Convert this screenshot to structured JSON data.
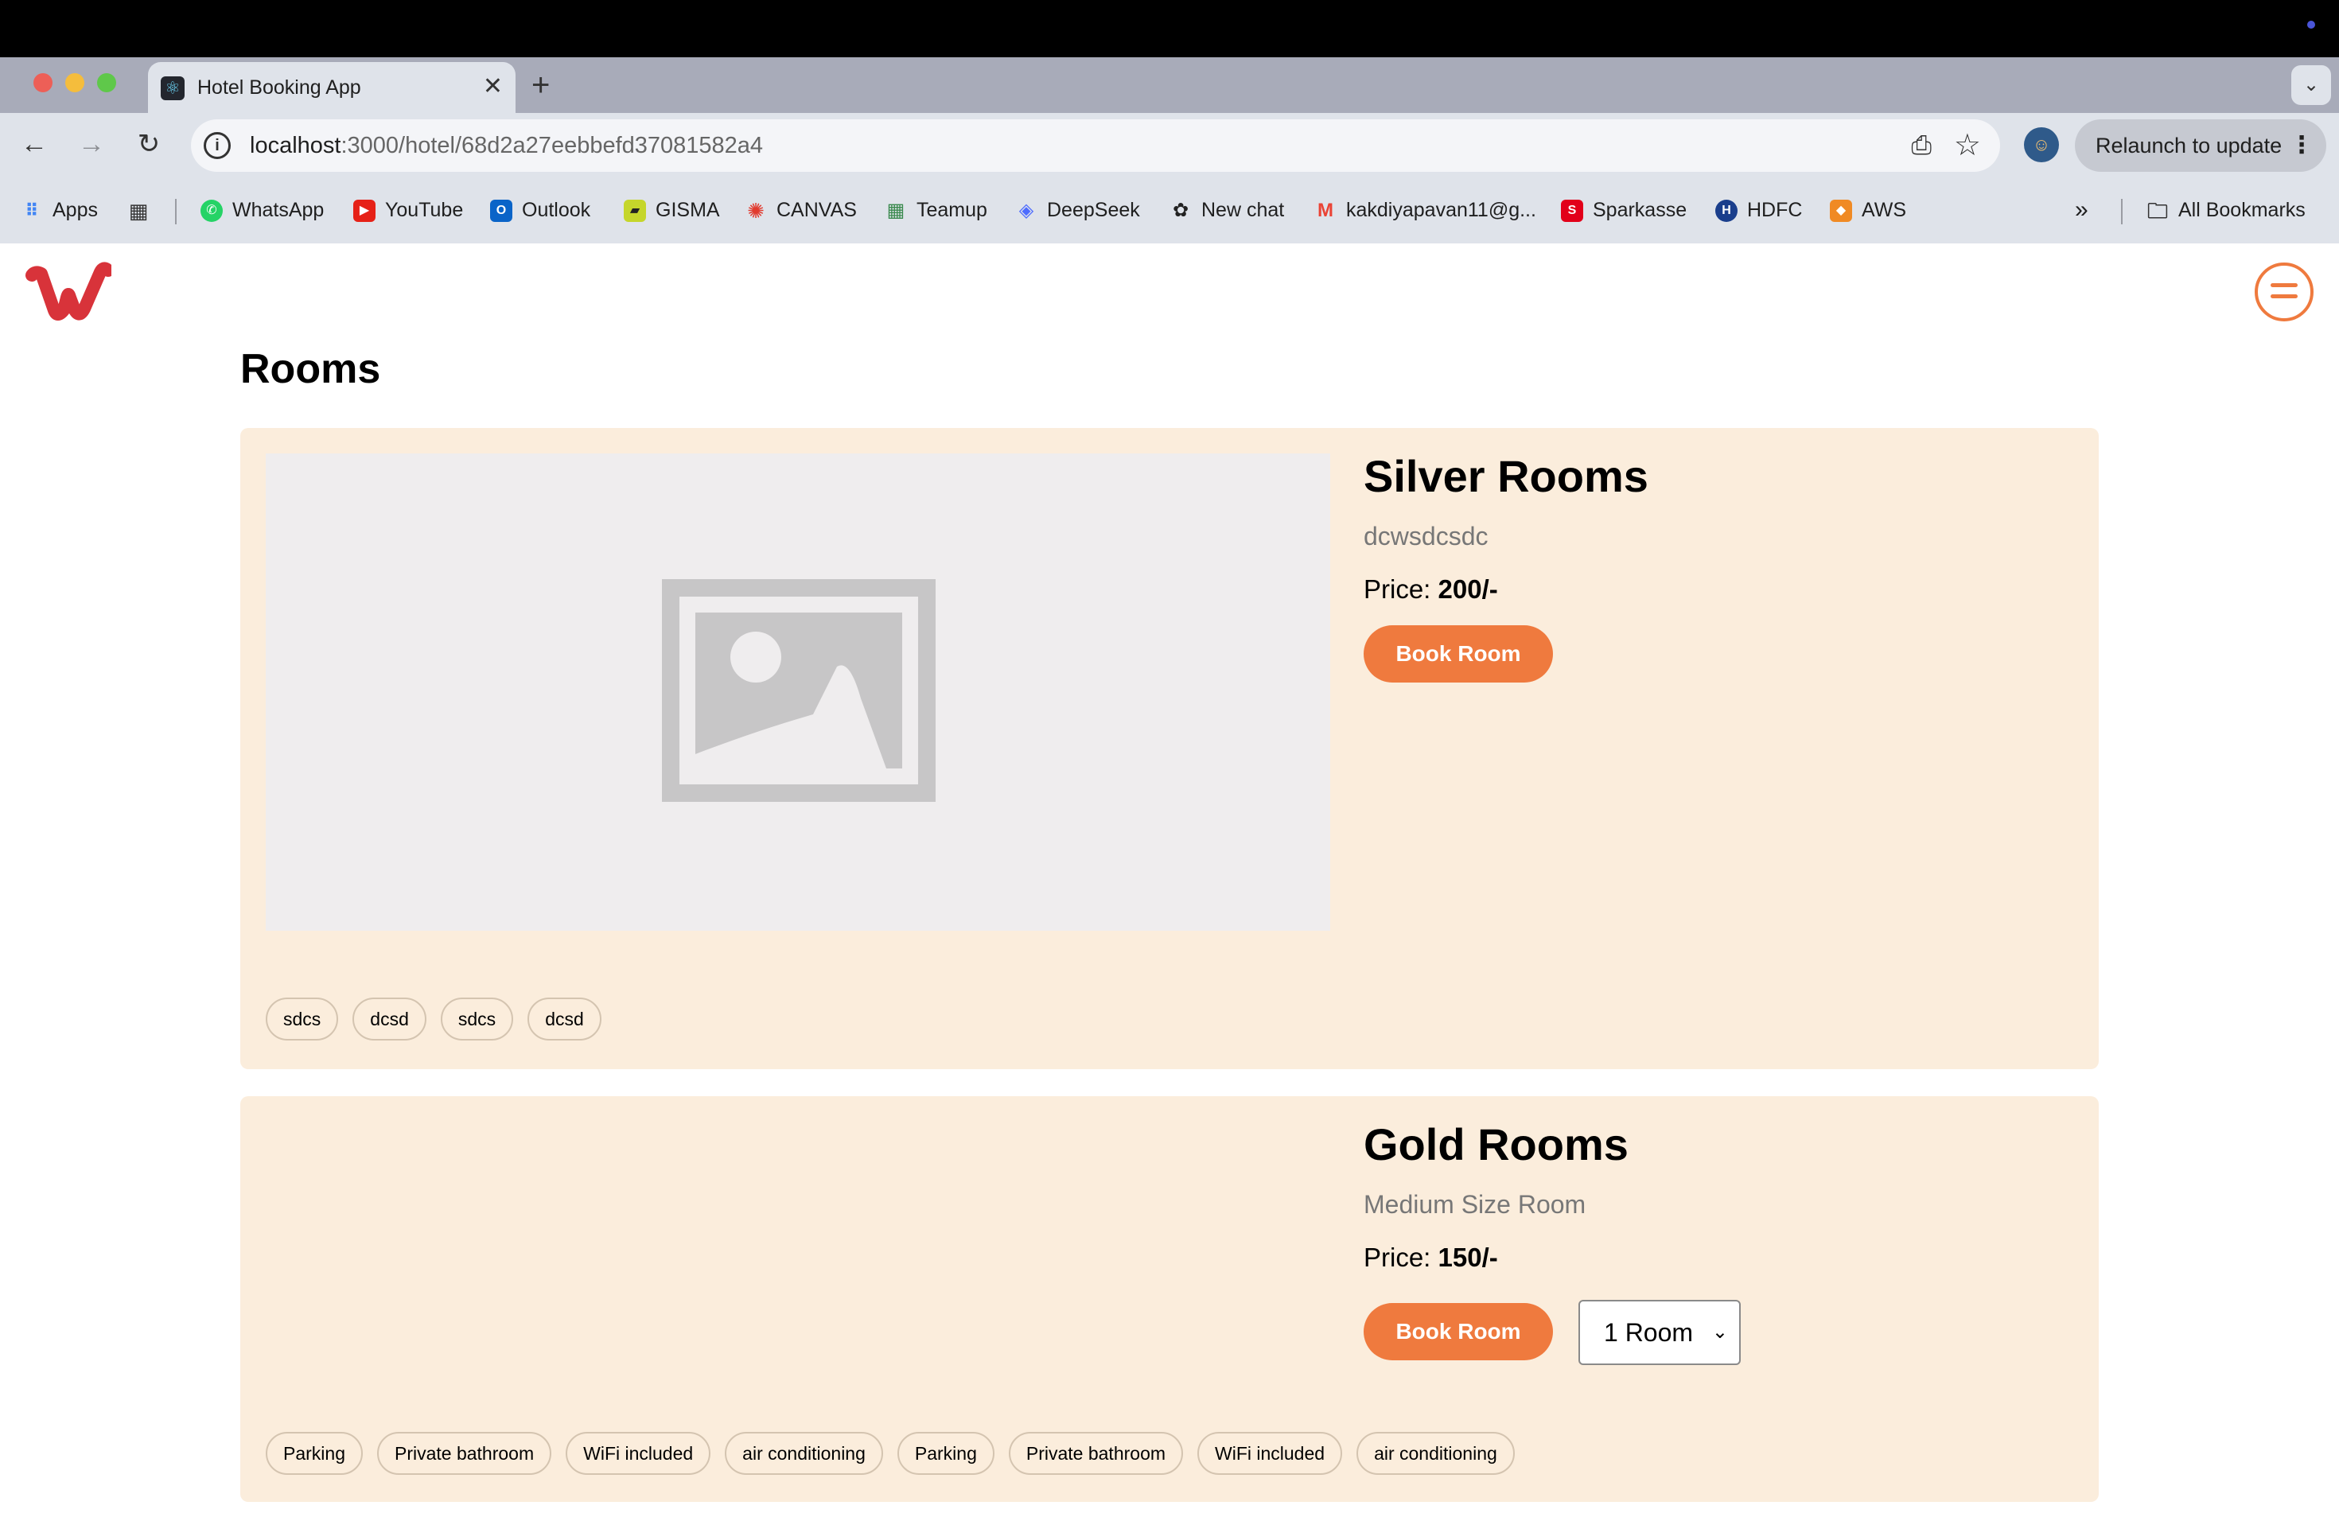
{
  "browser": {
    "tab_title": "Hotel Booking App",
    "url_host": "localhost",
    "url_path": ":3000/hotel/68d2a27eebbefd37081582a4",
    "relaunch_label": "Relaunch to update",
    "bookmarks": [
      {
        "label": "Apps",
        "icon": "apps-grid-icon",
        "color": "#4285f4"
      },
      {
        "label": "WhatsApp",
        "icon": "whatsapp-icon",
        "color": "#25d366"
      },
      {
        "label": "YouTube",
        "icon": "youtube-icon",
        "color": "#e62117"
      },
      {
        "label": "Outlook",
        "icon": "outlook-icon",
        "color": "#0a64c8"
      },
      {
        "label": "GISMA",
        "icon": "gisma-icon",
        "color": "#c5d62b"
      },
      {
        "label": "CANVAS",
        "icon": "canvas-icon",
        "color": "#e13b2f"
      },
      {
        "label": "Teamup",
        "icon": "teamup-icon",
        "color": "#3a8a4e"
      },
      {
        "label": "DeepSeek",
        "icon": "deepseek-icon",
        "color": "#4d6bfe"
      },
      {
        "label": "New chat",
        "icon": "openai-icon",
        "color": "#222222"
      },
      {
        "label": "kakdiyapavan11@g...",
        "icon": "gmail-icon",
        "color": "#ea4335"
      },
      {
        "label": "Sparkasse",
        "icon": "sparkasse-icon",
        "color": "#e2001a"
      },
      {
        "label": "HDFC",
        "icon": "hdfc-icon",
        "color": "#1a3e8c"
      },
      {
        "label": "AWS",
        "icon": "aws-icon",
        "color": "#f08a24"
      }
    ],
    "all_bookmarks_label": "All Bookmarks"
  },
  "page": {
    "title": "Rooms",
    "accent_color": "#ef7a3e",
    "rooms": [
      {
        "name": "Silver Rooms",
        "description": "dcwsdcsdc",
        "price_label": "Price: ",
        "price_value": "200/-",
        "book_label": "Book Room",
        "amenities": [
          "sdcs",
          "dcsd",
          "sdcs",
          "dcsd"
        ]
      },
      {
        "name": "Gold Rooms",
        "description": "Medium Size Room",
        "price_label": "Price: ",
        "price_value": "150/-",
        "book_label": "Book Room",
        "rooms_selected": "1 Room",
        "amenities": [
          "Parking",
          "Private bathroom",
          "WiFi included",
          "air conditioning",
          "Parking",
          "Private bathroom",
          "WiFi included",
          "air conditioning"
        ]
      }
    ]
  }
}
